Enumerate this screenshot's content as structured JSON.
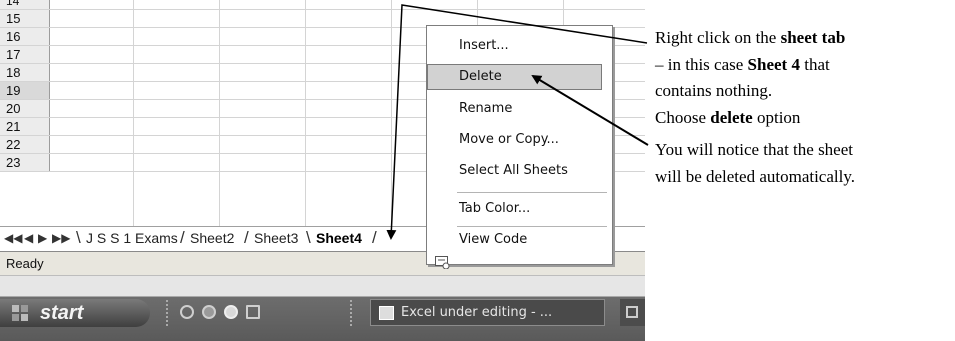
{
  "grid": {
    "row_numbers": [
      "14",
      "15",
      "16",
      "17",
      "18",
      "19",
      "20",
      "21",
      "22",
      "23"
    ],
    "selected_row": "19"
  },
  "sheet_tabs": {
    "nav_icons": [
      "first-sheet-icon",
      "previous-sheet-icon",
      "next-sheet-icon",
      "last-sheet-icon"
    ],
    "tabs": [
      "J S S 1 Exams",
      "Sheet2",
      "Sheet3",
      "Sheet4"
    ],
    "active_tab": "Sheet4"
  },
  "status_bar": {
    "text": "Ready"
  },
  "taskbar": {
    "start_label": "start",
    "window_label": "Excel under editing - ..."
  },
  "context_menu": {
    "items": [
      "Insert...",
      "Delete",
      "Rename",
      "Move or Copy...",
      "Select All Sheets",
      "Tab Color...",
      "View Code"
    ],
    "highlighted": "Delete"
  },
  "annotation": {
    "line1_a": "Right click on the ",
    "line1_b": "sheet tab",
    "line2_a": "– in this case ",
    "line2_b": "Sheet 4",
    "line2_c": " that",
    "line3": "contains nothing.",
    "line4_a": "Choose ",
    "line4_b": "delete",
    "line4_c": " option",
    "line5": "You will notice that the sheet",
    "line6": "will be deleted automatically."
  },
  "colors": {
    "menu_highlight": "#d2d2d2",
    "taskbar": "#5a5a5a",
    "status_bar": "#e8e6de"
  }
}
